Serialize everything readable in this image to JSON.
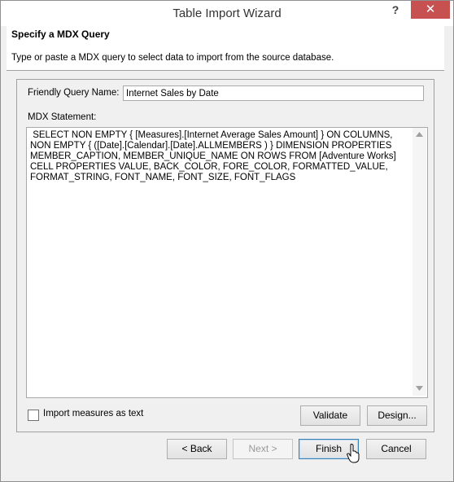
{
  "window": {
    "title": "Table Import Wizard",
    "help_label": "?",
    "close_label": "✕"
  },
  "header": {
    "title": "Specify a MDX Query",
    "description": "Type or paste a MDX query to select data to import from the source database."
  },
  "form": {
    "friendly_name_label": "Friendly Query Name:",
    "friendly_name_value": "Internet Sales by Date",
    "mdx_label": "MDX Statement:",
    "mdx_value": " SELECT NON EMPTY { [Measures].[Internet Average Sales Amount] } ON COLUMNS, NON EMPTY { ([Date].[Calendar].[Date].ALLMEMBERS ) } DIMENSION PROPERTIES MEMBER_CAPTION, MEMBER_UNIQUE_NAME ON ROWS FROM [Adventure Works] CELL PROPERTIES VALUE, BACK_COLOR, FORE_COLOR, FORMATTED_VALUE, FORMAT_STRING, FONT_NAME, FONT_SIZE, FONT_FLAGS",
    "import_measures_label": "Import measures as text",
    "import_measures_checked": false,
    "validate_label": "Validate",
    "design_label": "Design..."
  },
  "footer": {
    "back_label": "< Back",
    "next_label": "Next >",
    "finish_label": "Finish",
    "cancel_label": "Cancel"
  },
  "colors": {
    "close_button": "#c75050",
    "window_bg": "#f0f0f0",
    "default_button_border": "#3c7fb1"
  },
  "icons": {
    "scroll_up": "up-arrow-icon",
    "scroll_down": "down-arrow-icon",
    "cursor": "mouse-pointer-icon"
  }
}
